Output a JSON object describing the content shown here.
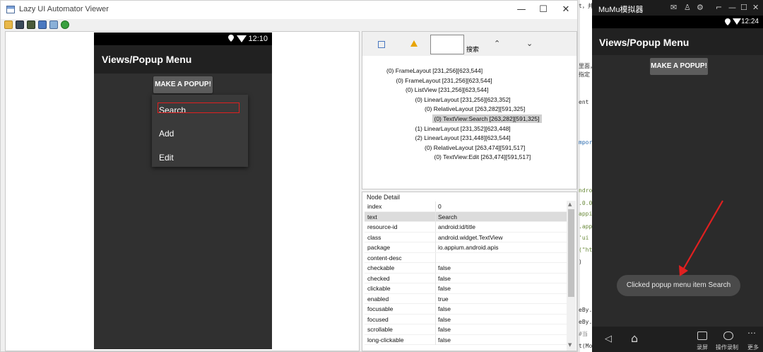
{
  "viewer": {
    "title": "Lazy UI Automator Viewer",
    "controls": {
      "minimize": "—",
      "maximize": "☐",
      "close": "✕"
    },
    "toolbar_icons": [
      "open-folder-icon",
      "screenshot-icon",
      "screenshot-compressed-icon",
      "save-icon",
      "export-icon",
      "refresh-icon"
    ],
    "device": {
      "status_time": "12:10",
      "app_title": "Views/Popup Menu",
      "popup_button": "MAKE A POPUP!",
      "menu_items": [
        "Search",
        "Add",
        "Edit"
      ]
    },
    "tree_tools": {
      "search_label": "搜索",
      "prev": "⌃",
      "next": "⌄"
    },
    "tree": [
      {
        "text": "(0) FrameLayout [231,256][623,544]",
        "level": 0,
        "highlight": false
      },
      {
        "text": "(0) FrameLayout [231,256][623,544]",
        "level": 1,
        "highlight": false
      },
      {
        "text": "(0) ListView [231,256][623,544]",
        "level": 2,
        "highlight": false
      },
      {
        "text": "(0) LinearLayout [231,256][623,352]",
        "level": 3,
        "highlight": false
      },
      {
        "text": "(0) RelativeLayout [263,282][591,325]",
        "level": 4,
        "highlight": false
      },
      {
        "text": "(0) TextView:Search [263,282][591,325]",
        "level": 5,
        "highlight": true
      },
      {
        "text": "(1) LinearLayout [231,352][623,448]",
        "level": 3,
        "highlight": false
      },
      {
        "text": "(2) LinearLayout [231,448][623,544]",
        "level": 3,
        "highlight": false
      },
      {
        "text": "(0) RelativeLayout [263,474][591,517]",
        "level": 4,
        "highlight": false
      },
      {
        "text": "(0) TextView:Edit [263,474][591,517]",
        "level": 5,
        "highlight": false
      }
    ],
    "node_detail": {
      "title": "Node Detail",
      "rows": [
        {
          "key": "index",
          "value": "0"
        },
        {
          "key": "text",
          "value": "Search"
        },
        {
          "key": "resource-id",
          "value": "android:id/title"
        },
        {
          "key": "class",
          "value": "android.widget.TextView"
        },
        {
          "key": "package",
          "value": "io.appium.android.apis"
        },
        {
          "key": "content-desc",
          "value": ""
        },
        {
          "key": "checkable",
          "value": "false"
        },
        {
          "key": "checked",
          "value": "false"
        },
        {
          "key": "clickable",
          "value": "false"
        },
        {
          "key": "enabled",
          "value": "true"
        },
        {
          "key": "focusable",
          "value": "false"
        },
        {
          "key": "focused",
          "value": "false"
        },
        {
          "key": "scrollable",
          "value": "false"
        },
        {
          "key": "long-clickable",
          "value": "false"
        }
      ],
      "selected_row": 1
    }
  },
  "code_fragments": [
    {
      "text": "t，并",
      "color": "#333333"
    },
    {
      "text": "里面，",
      "color": "#333333"
    },
    {
      "text": "指定",
      "color": "#333333"
    },
    {
      "text": "ent",
      "color": "#333333"
    },
    {
      "text": "mpor",
      "color": "#2b6cb0"
    },
    {
      "text": "ndro",
      "color": "#6a8a3a"
    },
    {
      "text": ".0.0",
      "color": "#6a8a3a"
    },
    {
      "text": "appi",
      "color": "#6a8a3a"
    },
    {
      "text": ".app",
      "color": "#6a8a3a"
    },
    {
      "text": "'ui",
      "color": "#6a8a3a"
    },
    {
      "text": "(\"ht",
      "color": "#6a8a3a"
    },
    {
      "text": ")",
      "color": "#333333"
    },
    {
      "text": "eBy.",
      "color": "#333333"
    },
    {
      "text": "eBy.",
      "color": "#333333"
    },
    {
      "text": "#当",
      "color": "#888888"
    },
    {
      "text": "t(Mo",
      "color": "#333333"
    }
  ],
  "emulator": {
    "title": "MuMu模拟器",
    "status_time": "12:24",
    "app_title": "Views/Popup Menu",
    "popup_button": "MAKE A POPUP!",
    "toast": "Clicked popup menu item Search",
    "nav": {
      "back": "◁",
      "home": "⌂"
    },
    "tools": [
      "录屏",
      "操作录制",
      "更多"
    ],
    "arrow_color": "#e02020"
  }
}
